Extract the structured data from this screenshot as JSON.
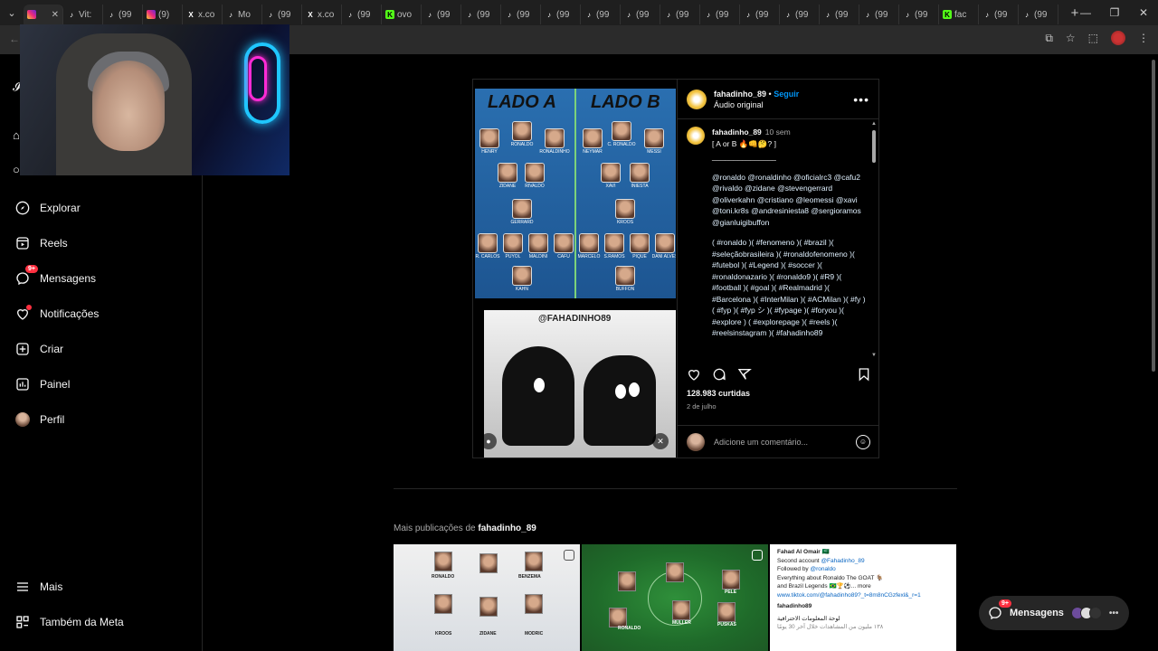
{
  "browser": {
    "tabs": [
      {
        "icon": "instagram-icon",
        "label": "",
        "active": true
      },
      {
        "icon": "tiktok-icon",
        "label": "Vit:"
      },
      {
        "icon": "tiktok-icon",
        "label": "(99"
      },
      {
        "icon": "instagram-icon",
        "label": "(9)"
      },
      {
        "icon": "x-icon",
        "label": "x.co"
      },
      {
        "icon": "tiktok-icon",
        "label": "Mo"
      },
      {
        "icon": "tiktok-icon",
        "label": "(99"
      },
      {
        "icon": "x-icon",
        "label": "x.co"
      },
      {
        "icon": "tiktok-icon",
        "label": "(99"
      },
      {
        "icon": "kick-icon",
        "label": "ovo"
      },
      {
        "icon": "tiktok-icon",
        "label": "(99"
      },
      {
        "icon": "tiktok-icon",
        "label": "(99"
      },
      {
        "icon": "tiktok-icon",
        "label": "(99"
      },
      {
        "icon": "tiktok-icon",
        "label": "(99"
      },
      {
        "icon": "tiktok-icon",
        "label": "(99"
      },
      {
        "icon": "tiktok-icon",
        "label": "(99"
      },
      {
        "icon": "tiktok-icon",
        "label": "(99"
      },
      {
        "icon": "tiktok-icon",
        "label": "(99"
      },
      {
        "icon": "tiktok-icon",
        "label": "(99"
      },
      {
        "icon": "tiktok-icon",
        "label": "(99"
      },
      {
        "icon": "tiktok-icon",
        "label": "(99"
      },
      {
        "icon": "tiktok-icon",
        "label": "(99"
      },
      {
        "icon": "tiktok-icon",
        "label": "(99"
      },
      {
        "icon": "kick-icon",
        "label": "fac"
      },
      {
        "icon": "tiktok-icon",
        "label": "(99"
      },
      {
        "icon": "tiktok-icon",
        "label": "(99"
      }
    ],
    "new_tab": "+"
  },
  "sidebar": {
    "items": [
      {
        "label": "Explorar",
        "icon": "compass-icon"
      },
      {
        "label": "Reels",
        "icon": "reels-icon"
      },
      {
        "label": "Mensagens",
        "icon": "messenger-icon",
        "badge": "9+"
      },
      {
        "label": "Notificações",
        "icon": "heart-icon"
      },
      {
        "label": "Criar",
        "icon": "plus-square-icon"
      },
      {
        "label": "Painel",
        "icon": "dashboard-icon"
      },
      {
        "label": "Perfil",
        "icon": "avatar"
      }
    ],
    "bottom": [
      {
        "label": "Mais",
        "icon": "menu-icon"
      },
      {
        "label": "Também da Meta",
        "icon": "meta-icon"
      }
    ]
  },
  "post": {
    "username": "fahadinho_89",
    "separator": "•",
    "follow_label": "Seguir",
    "audio": "Áudio original",
    "image": {
      "left_title": "LADO A",
      "right_title": "LADO B",
      "players_a": [
        "HENRY",
        "RONALDO",
        "RONALDINHO",
        "ZIDANE",
        "RIVALDO",
        "GERRARD",
        "R. CARLOS",
        "PUYOL",
        "MALDINI",
        "CAFU",
        "KAHN"
      ],
      "players_b": [
        "NEYMAR",
        "C. RONALDO",
        "MESSI",
        "XAVI",
        "INIESTA",
        "KROOS",
        "MARCELO",
        "S.RAMOS",
        "PIQUE",
        "DANI ALVES",
        "BUFFON"
      ],
      "watermark": "@FAHADINHO89"
    },
    "caption": {
      "username": "fahadinho_89",
      "time": "10 sem",
      "first_line": "[ A or B 🔥👊🤔? ]",
      "rule": "_______________",
      "mentions": "@ronaldo @ronaldinho @oficialrc3 @cafu2 @rivaldo @zidane @stevengerrard @oliverkahn @cristiano @leomessi @xavi @toni.kr8s @andresiniesta8 @sergioramos @gianluigibuffon",
      "hashtags": "( #ronaldo )( #fenomeno )( #brazil )( #seleçãobrasileira )( #ronaldofenomeno )( #futebol )( #Legend )( #soccer )( #ronaldonazario )( #ronaldo9 )( #R9 )( #football )( #goal )( #Realmadrid )( #Barcelona )( #InterMilan )( #ACMilan )( #fy )( #fyp )( #fyp シ )( #fypage )( #foryou )( #explore ) ( #explorepage )( #reels )( #reelsinstagram )( #fahadinho89"
    },
    "views": "128.983 curtidas",
    "date": "2 de julho",
    "comment_placeholder": "Adicione um comentário..."
  },
  "more": {
    "prefix": "Mais publicações de",
    "username": "fahadinho_89",
    "thumb1_names": [
      "RONALDO",
      "BENZEMA",
      "KROOS",
      "ZIDANE",
      "MODRIC"
    ],
    "thumb2_names": [
      "RONALDO",
      "MULLER",
      "PUSKAS",
      "PELE"
    ],
    "thumb3": {
      "line1": "Fahad Al Omair 🇸🇦",
      "line2_prefix": "Second account",
      "line2_link": "@Fahadinho_89",
      "line3_prefix": "Followed by",
      "line3_link": "@ronaldo",
      "line4": "Everything about Ronaldo The GOAT 🐐",
      "line5": "and Brazil Legends 🇧🇷🏆⚽... more",
      "line6": "www.tiktok.com/@fahadinho89?_t=8m8nCGzfexl&_r=1",
      "line7": "fahadinho89",
      "line8": "لوحة المعلومات الاحترافية",
      "line9": "١٣٨ مليون من المشاهدات خلال آخر 30 يومًا"
    }
  },
  "floating_messages": {
    "label": "Mensagens",
    "badge": "9+"
  }
}
